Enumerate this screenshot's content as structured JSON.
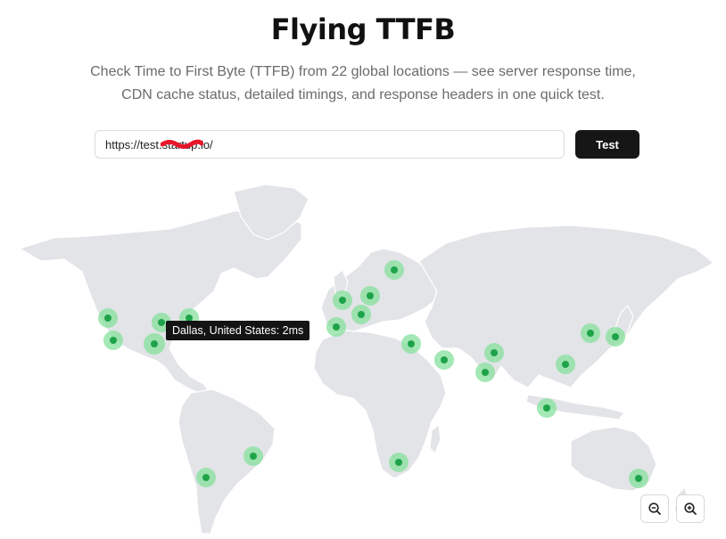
{
  "header": {
    "title": "Flying TTFB",
    "subtitle_line1": "Check Time to First Byte (TTFB) from 22 global locations — see server response time,",
    "subtitle_line2": "CDN cache status, detailed timings, and response headers in one quick test."
  },
  "form": {
    "url_value": "https://test.startup.io/",
    "test_label": "Test"
  },
  "map": {
    "tooltip": "Dallas, United States: 2ms",
    "land_color": "#e2e4e7",
    "marker_color": "#1fa34a",
    "marker_halo_color": "#86e09c",
    "zoom_out_icon": "zoom-out-icon",
    "zoom_in_icon": "zoom-in-icon"
  }
}
